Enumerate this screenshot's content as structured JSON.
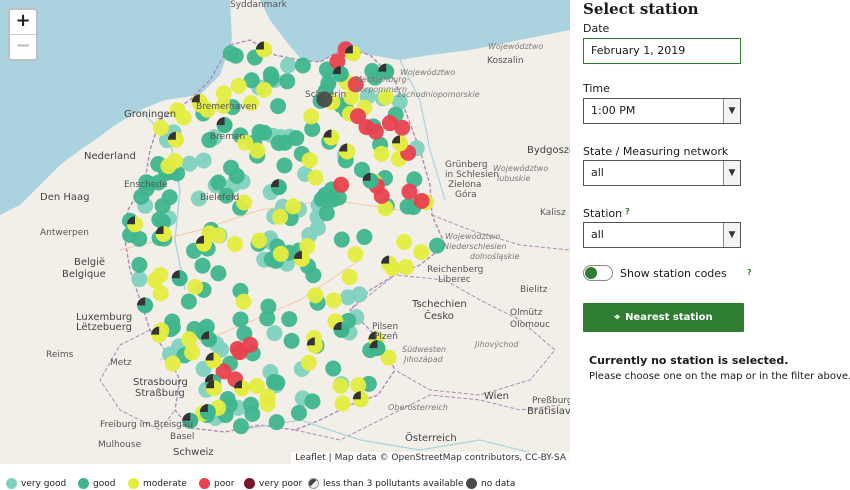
{
  "map": {
    "zoom_in": "+",
    "zoom_out": "−",
    "attribution": "Leaflet | Map data © OpenStreetMap contributors, CC-BY-SA",
    "labels": {
      "sydd": "Syddanmark",
      "koszalin": "Koszalin",
      "kosz_woj": "Województwo",
      "kosz_woj2": "zachodniopomorskie",
      "mecklenburg": "Mecklenburg-",
      "vorpommern": "Vorpommern",
      "woj_west": "Województwo",
      "woj_west2": "zachodniopomorskie",
      "groningen": "Groningen",
      "bremerhaven": "Bremerhaven",
      "schwerin": "Schwerin",
      "bremen": "Bremen",
      "nederland": "Nederland",
      "enschede": "Enschede",
      "den_haag": "Den Haag",
      "antwerpen": "Antwerpen",
      "belgie": "België",
      "belgique": "Belgique",
      "bielefeld": "Bielefeld",
      "gruenberg": "Grünberg",
      "in_schlesien": "in Schlesien",
      "zielona": "Zielona",
      "gora": "Góra",
      "woj_lub": "Województwo",
      "woj_lub2": "lubuskie",
      "bydgoszcz": "Bydgoszcz",
      "kalisz": "Kalisz",
      "woj_nied": "Województwo",
      "woj_nied2": "dolnośląskie",
      "niederschlesien": "Niederschlesien",
      "luxemburg": "Luxemburg",
      "letzebuerg": "Lëtzebuerg",
      "reims": "Reims",
      "metz": "Metz",
      "strasbourg": "Strasbourg",
      "strassburg": "Straßburg",
      "reichenberg": "Reichenberg",
      "liberec": "Liberec",
      "tschechien": "Tschechien",
      "cesko": "Česko",
      "olmuetz": "Olmütz",
      "olomouc": "Olomouc",
      "pilsen": "Pilsen",
      "plzen": "Plzeň",
      "suedwesten": "Südwesten",
      "jihozapad": "Jihozápad",
      "jihovychod": "Jihovýchod",
      "wien": "Wien",
      "bratislava": "Bratislava",
      "pressburg": "Preßburg",
      "oberosterreich": "Oberösterreich",
      "osterreich": "Österreich",
      "freiburg": "Freiburg im Breisgau",
      "schweiz": "Schweiz",
      "basel": "Basel",
      "muelhausen": "Mülhausen",
      "mulhouse": "Mulhouse",
      "bilowitz": "Bielitz"
    }
  },
  "legend": [
    {
      "label": "very good",
      "color": "#7fd1c0"
    },
    {
      "label": "good",
      "color": "#3fb58e"
    },
    {
      "label": "moderate",
      "color": "#e4ec40"
    },
    {
      "label": "poor",
      "color": "#e8414f"
    },
    {
      "label": "very poor",
      "color": "#7a1528"
    },
    {
      "label": "less than 3 pollutants available",
      "color": "#8a8a8a"
    },
    {
      "label": "no data",
      "color": "#4a4a4a"
    }
  ],
  "panel": {
    "title": "Select station",
    "date_label": "Date",
    "date_value": "February 1, 2019",
    "time_label": "Time",
    "time_value": "1:00 PM",
    "state_label": "State / Measuring network",
    "state_value": "all",
    "station_label": "Station",
    "station_value": "all",
    "help_mark": "?",
    "toggle_label": "Show station codes",
    "nearest_button": "Nearest station",
    "message_title": "Currently no station is selected.",
    "message_body": "Please choose one on the map or in the filter above."
  },
  "stations": {
    "count_by_category": {
      "very good": 60,
      "good": 125,
      "moderate": 65,
      "poor": 19,
      "no data": 1,
      "less than 3 pollutants available": 34
    }
  }
}
